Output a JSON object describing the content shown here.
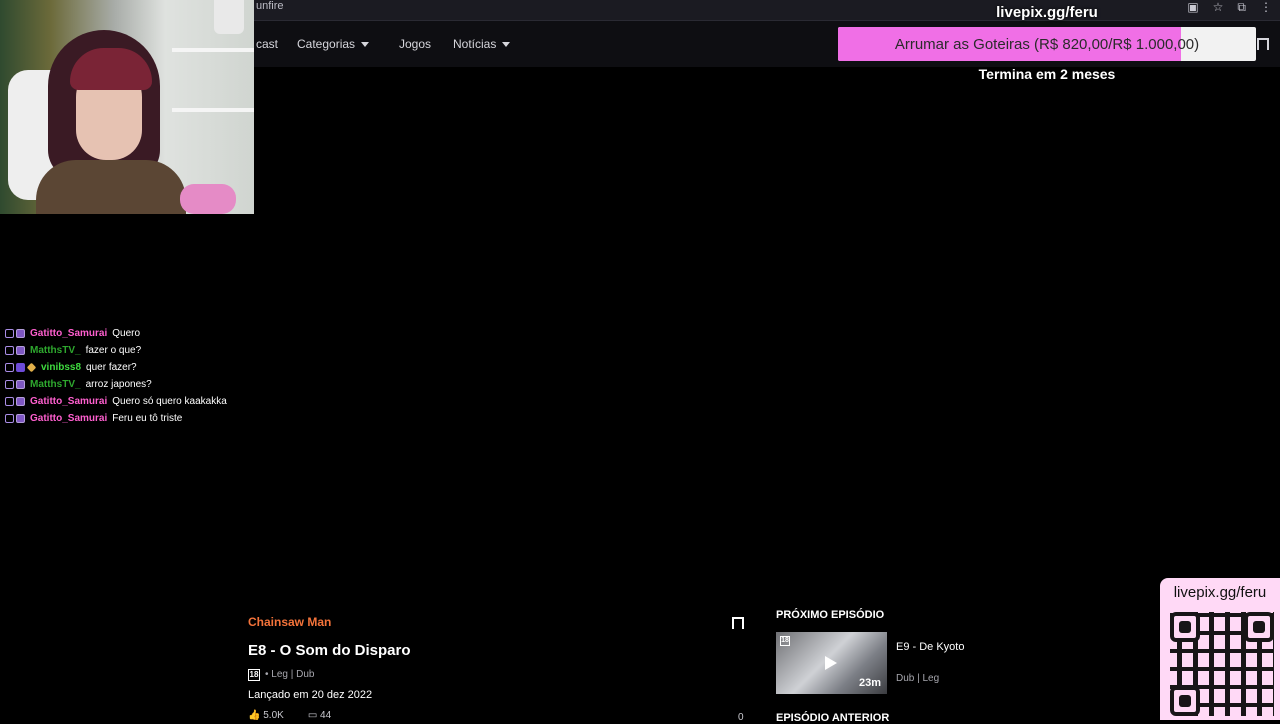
{
  "browser": {
    "url_fragment": "unfire",
    "icons": [
      "screen-share-icon",
      "star-icon",
      "extensions-icon",
      "menu-icon"
    ]
  },
  "nav": {
    "items": [
      {
        "label": "cast"
      },
      {
        "label": "Categorias",
        "dropdown": true
      },
      {
        "label": "Jogos"
      },
      {
        "label": "Notícias",
        "dropdown": true
      }
    ]
  },
  "livepix": {
    "url": "livepix.gg/feru",
    "goal_text": "Arrumar as Goteiras (R$ 820,00/R$ 1.000,00)",
    "goal_progress": 0.82,
    "goal_subtitle": "Termina em 2 meses",
    "fill_color": "#f06fe6"
  },
  "chat": [
    {
      "user": "Gatitto_Samurai",
      "color": "#ff5fcf",
      "badges": [
        "chat",
        "sub"
      ],
      "message": "Quero"
    },
    {
      "user": "MatthsTV_",
      "color": "#2ea82e",
      "badges": [
        "chat",
        "sub2"
      ],
      "message": "fazer o que?"
    },
    {
      "user": "vinibss8",
      "color": "#3fdc3f",
      "badges": [
        "chat",
        "star",
        "gem"
      ],
      "message": "quer fazer?"
    },
    {
      "user": "MatthsTV_",
      "color": "#2ea82e",
      "badges": [
        "chat",
        "sub2"
      ],
      "message": "arroz japones?"
    },
    {
      "user": "Gatitto_Samurai",
      "color": "#ff5fcf",
      "badges": [
        "chat",
        "sub"
      ],
      "message": "Quero só quero kaakakka"
    },
    {
      "user": "Gatitto_Samurai",
      "color": "#ff5fcf",
      "badges": [
        "chat",
        "sub"
      ],
      "message": "Feru eu tô triste"
    }
  ],
  "episode": {
    "series": "Chainsaw Man",
    "title": "E8 - O Som do Disparo",
    "rating": "18",
    "langs": "• Leg | Dub",
    "released": "Lançado em 20 dez 2022",
    "likes": "5.0K",
    "comments": "44",
    "zero": "0"
  },
  "next": {
    "label": "PRÓXIMO EPISÓDIO",
    "title": "E9 - De Kyoto",
    "langs": "Dub | Leg",
    "duration": "23m",
    "rating": "18",
    "prev_label": "EPISÓDIO ANTERIOR"
  },
  "qr": {
    "url": "livepix.gg/feru"
  }
}
